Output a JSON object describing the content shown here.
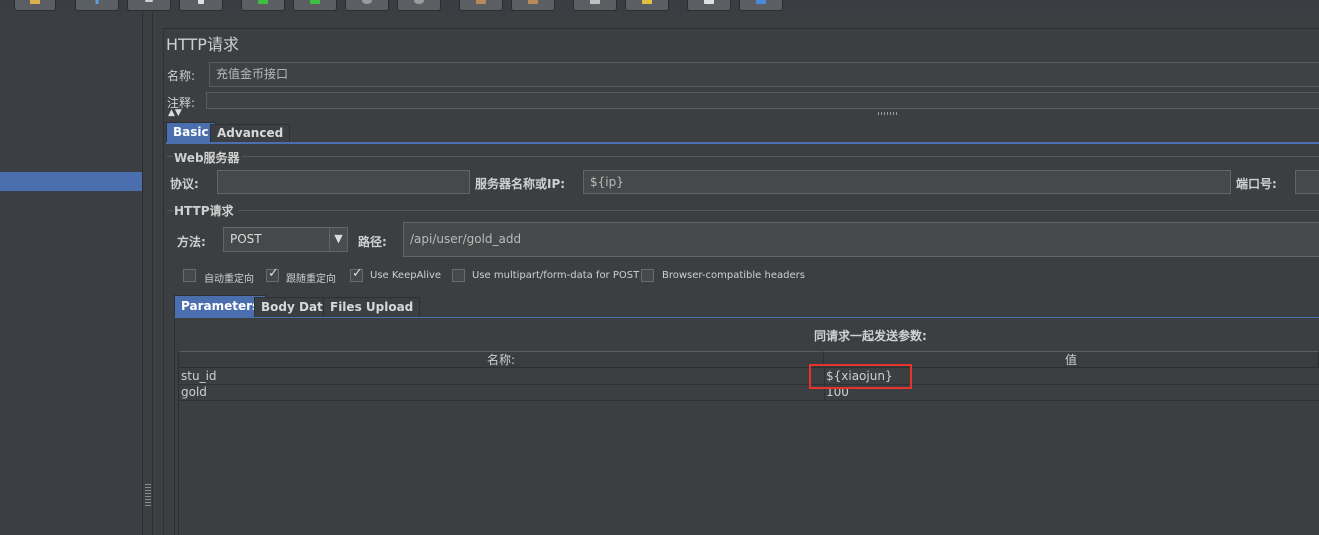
{
  "window": {
    "panel_title": "HTTP请求"
  },
  "name_field": {
    "label": "名称:",
    "value": "充值金币接口"
  },
  "comment_field": {
    "label": "注释:",
    "value": ""
  },
  "tabs": [
    {
      "label": "Basic",
      "active": true
    },
    {
      "label": "Advanced",
      "active": false
    }
  ],
  "web_server": {
    "group_title": "Web服务器",
    "protocol_label": "协议:",
    "protocol_value": "",
    "server_label": "服务器名称或IP:",
    "server_value": "${ip}",
    "port_label": "端口号:",
    "port_value": ""
  },
  "http_request": {
    "group_title": "HTTP请求",
    "method_label": "方法:",
    "method_value": "POST",
    "path_label": "路径:",
    "path_value": "/api/user/gold_add"
  },
  "options": [
    {
      "label": "自动重定向",
      "checked": false
    },
    {
      "label": "跟随重定向",
      "checked": true
    },
    {
      "label": "Use KeepAlive",
      "checked": true
    },
    {
      "label": "Use multipart/form-data for POST",
      "checked": false
    },
    {
      "label": "Browser-compatible headers",
      "checked": false
    }
  ],
  "param_tabs": [
    {
      "label": "Parameters",
      "active": true
    },
    {
      "label": "Body Data",
      "active": false
    },
    {
      "label": "Files Upload",
      "active": false
    }
  ],
  "params": {
    "caption": "同请求一起发送参数:",
    "columns": [
      "名称:",
      "值"
    ],
    "rows": [
      {
        "name": "stu_id",
        "value": "${xiaojun}",
        "highlighted": true
      },
      {
        "name": "gold",
        "value": "100",
        "highlighted": false
      }
    ]
  },
  "colors": {
    "accent": "#4b6eaf",
    "background": "#3c3f41",
    "highlight": "#e8332d"
  }
}
